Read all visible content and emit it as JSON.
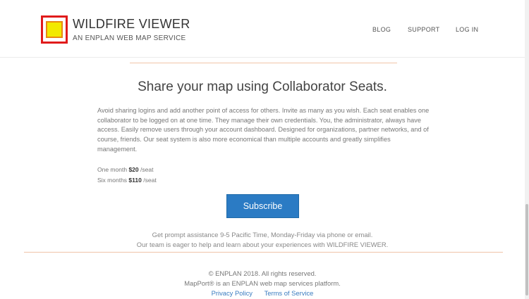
{
  "header": {
    "title": "WILDFIRE VIEWER",
    "subtitle": "AN ENPLAN WEB MAP SERVICE",
    "nav": {
      "blog": "BLOG",
      "support": "SUPPORT",
      "login": "LOG IN"
    }
  },
  "main": {
    "headline": "Share your map using Collaborator Seats.",
    "description": "Avoid sharing logins and add another point of access for others. Invite as many as you wish. Each seat enables one collaborator to be logged on at one time. They manage their own credentials. You, the administrator, always have access. Easily remove users through your account dashboard. Designed for organizations, partner networks, and of course, friends. Our seat system is also more economical than multiple accounts and greatly simplifies management.",
    "pricing": [
      {
        "period": "One month",
        "price": "$20",
        "unit": "/seat"
      },
      {
        "period": "Six months",
        "price": "$110",
        "unit": "/seat"
      }
    ],
    "subscribe_label": "Subscribe",
    "assist_line1": "Get prompt assistance 9-5 Pacific Time, Monday-Friday via phone or email.",
    "assist_line2": "Our team is eager to help and learn about your experiences with WILDFIRE VIEWER."
  },
  "footer": {
    "copyright": "© ENPLAN 2018. All rights reserved.",
    "platform": "MapPort® is an ENPLAN web map services platform.",
    "privacy": "Privacy Policy",
    "terms": "Terms of Service"
  },
  "colors": {
    "accent": "#2b7bc4",
    "logo_border": "#e01b1b",
    "logo_fill": "#f2e900",
    "divider": "#f0c4a8",
    "link": "#3a7cc0"
  }
}
